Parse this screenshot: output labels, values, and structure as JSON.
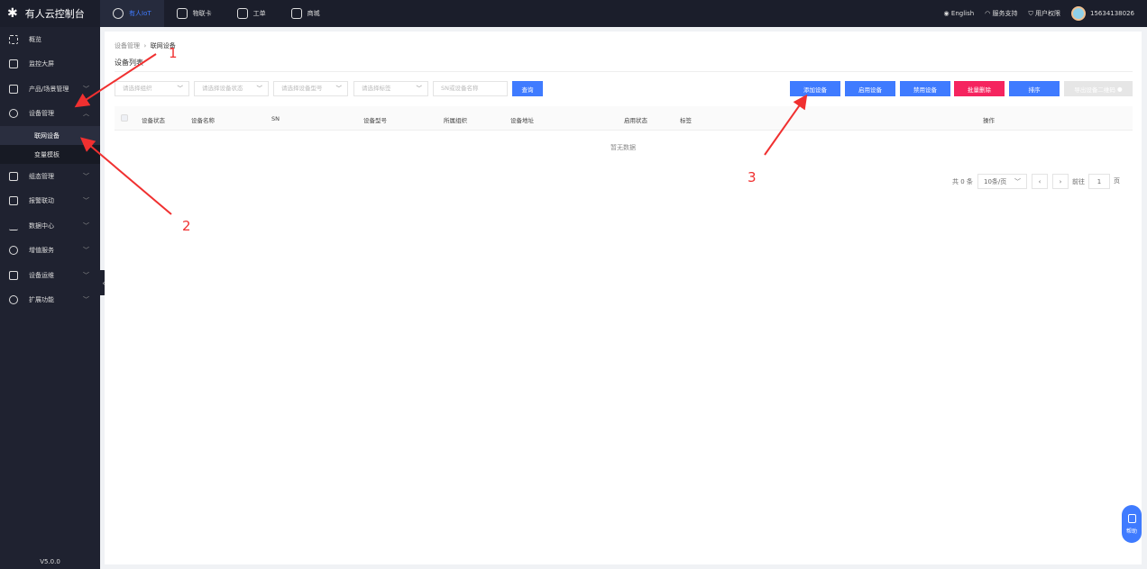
{
  "app": {
    "title": "有人云控制台",
    "nav": [
      "有人IoT",
      "物联卡",
      "工单",
      "商城"
    ],
    "language": "English",
    "support": "服务支持",
    "permissions": "用户权限",
    "user": "15634138026"
  },
  "sidebar": {
    "items": [
      {
        "label": "概览",
        "icon": "overview-icon"
      },
      {
        "label": "监控大屏",
        "icon": "monitor-icon"
      },
      {
        "label": "产品/场景管理",
        "icon": "cube-icon"
      },
      {
        "label": "设备管理",
        "icon": "pie-icon",
        "expanded": true,
        "children": [
          "联网设备",
          "变量模板"
        ]
      },
      {
        "label": "组态管理",
        "icon": "image-icon"
      },
      {
        "label": "报警联动",
        "icon": "alarm-icon"
      },
      {
        "label": "数据中心",
        "icon": "bar-chart-icon"
      },
      {
        "label": "增值服务",
        "icon": "coin-icon"
      },
      {
        "label": "设备运维",
        "icon": "pulse-icon"
      },
      {
        "label": "扩展功能",
        "icon": "layers-icon"
      }
    ],
    "version": "V5.0.0"
  },
  "breadcrumb": [
    "设备管理",
    "联网设备"
  ],
  "page_title": "设备列表",
  "filters": {
    "org": "请选择组织",
    "status": "请选择设备状态",
    "model": "请选择设备型号",
    "tag": "请选择标签",
    "search": "SN或设备名称",
    "query": "查询"
  },
  "actions": {
    "add": "添加设备",
    "enable": "启用设备",
    "disable": "禁用设备",
    "batch_delete": "批量删除",
    "sort": "排序",
    "export_qr": "导出设备二维码"
  },
  "table": {
    "columns": [
      "设备状态",
      "设备名称",
      "SN",
      "设备型号",
      "所属组织",
      "设备地址",
      "启用状态",
      "标签",
      "操作"
    ],
    "empty": "暂无数据"
  },
  "pagination": {
    "total": "共 0 条",
    "page_size": "10条/页",
    "goto": "前往",
    "page": "1",
    "page_suffix": "页"
  },
  "help": "帮助",
  "annotations": [
    "1",
    "2",
    "3"
  ],
  "colors": {
    "primary": "#3f7bff",
    "danger": "#f5245f",
    "annotation": "#f03030"
  }
}
